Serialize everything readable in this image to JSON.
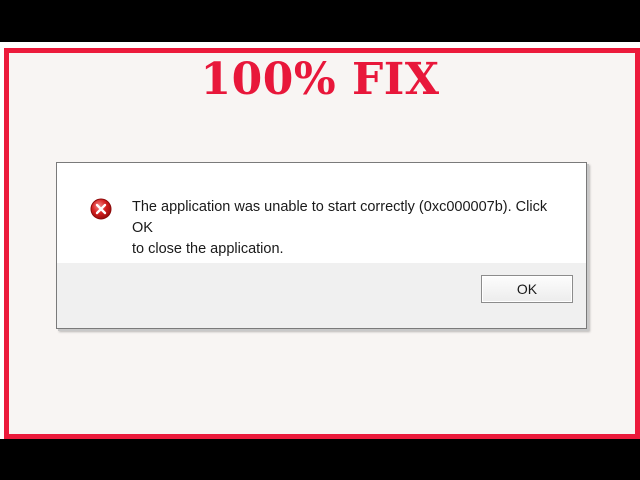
{
  "banner": {
    "headline": "100% FIX",
    "accent_color": "#ec1a3b"
  },
  "dialog": {
    "icon": "error-icon",
    "message_line1": "The application was unable to start correctly (0xc000007b). Click OK",
    "message_line2": "to close the application.",
    "ok_label": "OK"
  }
}
